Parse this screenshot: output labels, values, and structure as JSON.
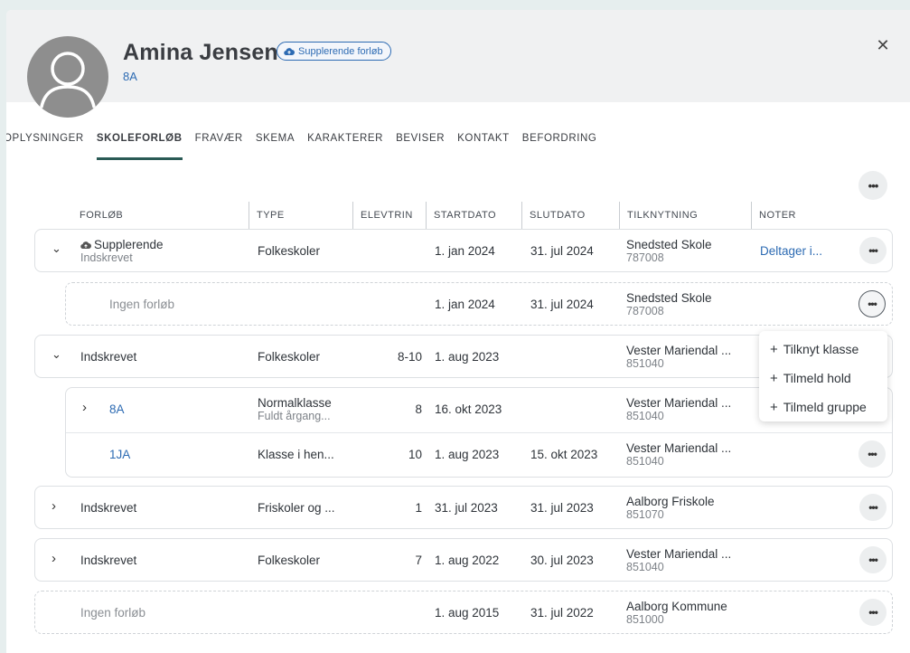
{
  "student": {
    "name": "Amina Jensen",
    "badge": "Supplerende forløb",
    "class": "8A"
  },
  "tabs": [
    "OPLYSNINGER",
    "SKOLEFORLØB",
    "FRAVÆR",
    "SKEMA",
    "KARAKTERER",
    "BEVISER",
    "KONTAKT",
    "BEFORDRING"
  ],
  "active_tab": "SKOLEFORLØB",
  "columns": {
    "forlob": "FORLØB",
    "type": "TYPE",
    "elevtrin": "ELEVTRIN",
    "startdato": "STARTDATO",
    "slutdato": "SLUTDATO",
    "tilknytning": "TILKNYTNING",
    "noter": "NOTER"
  },
  "rows": [
    {
      "forlob": "Supplerende",
      "forlob_sub": "Indskrevet",
      "type": "Folkeskoler",
      "elevtrin": "",
      "startdato": "1. jan 2024",
      "slutdato": "31. jul 2024",
      "tilknytning": "Snedsted Skole",
      "tilknytning_sub": "787008",
      "noter": "Deltager i..."
    },
    {
      "forlob": "Ingen forløb",
      "startdato": "1. jan 2024",
      "slutdato": "31. jul 2024",
      "tilknytning": "Snedsted Skole",
      "tilknytning_sub": "787008"
    },
    {
      "forlob": "Indskrevet",
      "type": "Folkeskoler",
      "elevtrin": "8-10",
      "startdato": "1. aug 2023",
      "slutdato": "",
      "tilknytning": "Vester Mariendal ...",
      "tilknytning_sub": "851040"
    },
    {
      "forlob": "8A",
      "type": "Normalklasse",
      "type_sub": "Fuldt årgang...",
      "elevtrin": "8",
      "startdato": "16. okt 2023",
      "slutdato": "",
      "tilknytning": "Vester Mariendal ...",
      "tilknytning_sub": "851040"
    },
    {
      "forlob": "1JA",
      "type": "Klasse i hen...",
      "elevtrin": "10",
      "startdato": "1. aug 2023",
      "slutdato": "15. okt 2023",
      "tilknytning": "Vester Mariendal ...",
      "tilknytning_sub": "851040"
    },
    {
      "forlob": "Indskrevet",
      "type": "Friskoler og ...",
      "elevtrin": "1",
      "startdato": "31. jul 2023",
      "slutdato": "31. jul 2023",
      "tilknytning": "Aalborg Friskole",
      "tilknytning_sub": "851070"
    },
    {
      "forlob": "Indskrevet",
      "type": "Folkeskoler",
      "elevtrin": "7",
      "startdato": "1. aug 2022",
      "slutdato": "30. jul 2023",
      "tilknytning": "Vester Mariendal ...",
      "tilknytning_sub": "851040"
    },
    {
      "forlob": "Ingen forløb",
      "startdato": "1. aug 2015",
      "slutdato": "31. jul 2022",
      "tilknytning": "Aalborg Kommune",
      "tilknytning_sub": "851000"
    }
  ],
  "menu": [
    "Tilknyt klasse",
    "Tilmeld hold",
    "Tilmeld gruppe"
  ],
  "colors": {
    "link": "#2d6bb3",
    "tab_underline": "#2a5a55",
    "avatar": "#8e8e8e"
  },
  "icons": [
    "person-icon",
    "cloud-upload-icon",
    "close-icon",
    "chevron-down-icon",
    "chevron-right-icon",
    "more-icon",
    "plus-icon"
  ]
}
